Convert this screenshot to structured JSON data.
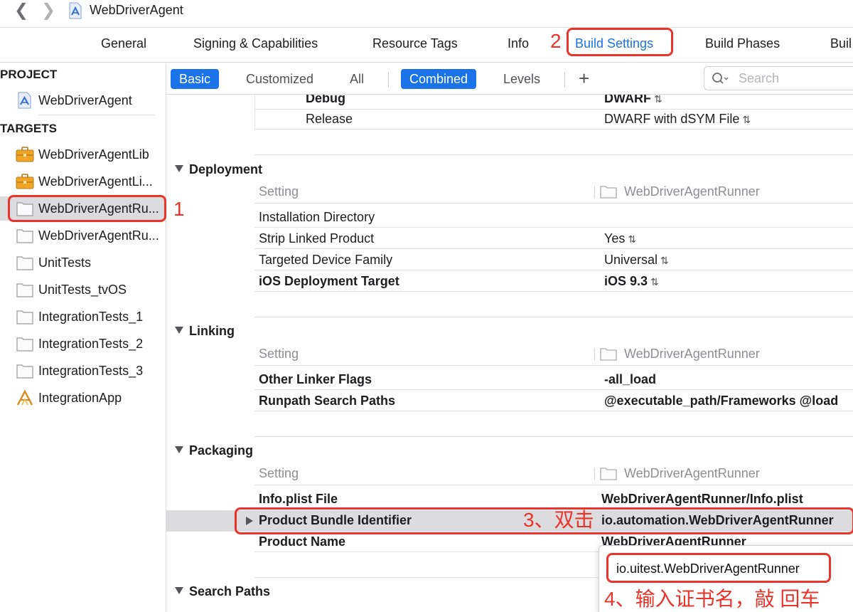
{
  "window": {
    "title": "WebDriverAgent"
  },
  "editor_tabs": [
    {
      "label": "General"
    },
    {
      "label": "Signing & Capabilities"
    },
    {
      "label": "Resource Tags"
    },
    {
      "label": "Info"
    },
    {
      "label": "Build Settings",
      "active": true
    },
    {
      "label": "Build Phases"
    },
    {
      "label": "Buil"
    }
  ],
  "sidebar": {
    "project_header": "PROJECT",
    "project_item": "WebDriverAgent",
    "targets_header": "TARGETS",
    "targets": [
      {
        "label": "WebDriverAgentLib",
        "icon": "toolbox-icon"
      },
      {
        "label": "WebDriverAgentLi...",
        "icon": "toolbox-icon"
      },
      {
        "label": "WebDriverAgentRu...",
        "icon": "test-bundle-icon",
        "selected": true
      },
      {
        "label": "WebDriverAgentRu...",
        "icon": "test-bundle-icon"
      },
      {
        "label": "UnitTests",
        "icon": "test-bundle-icon"
      },
      {
        "label": "UnitTests_tvOS",
        "icon": "test-bundle-icon"
      },
      {
        "label": "IntegrationTests_1",
        "icon": "test-bundle-icon"
      },
      {
        "label": "IntegrationTests_2",
        "icon": "test-bundle-icon"
      },
      {
        "label": "IntegrationTests_3",
        "icon": "test-bundle-icon"
      },
      {
        "label": "IntegrationApp",
        "icon": "app-icon"
      }
    ]
  },
  "filter_bar": {
    "basic": "Basic",
    "customized": "Customized",
    "all": "All",
    "combined": "Combined",
    "levels": "Levels",
    "add": "+",
    "search_placeholder": "Search"
  },
  "settings": {
    "top_rows": [
      {
        "name": "Debug",
        "value": "DWARF",
        "stepper": true
      },
      {
        "name": "Release",
        "value": "DWARF with dSYM File",
        "stepper": true
      }
    ],
    "column_header": "Setting",
    "target_column": "WebDriverAgentRunner",
    "deployment": {
      "title": "Deployment",
      "rows": [
        {
          "name": "Installation Directory",
          "value": "",
          "bold": false
        },
        {
          "name": "Strip Linked Product",
          "value": "Yes",
          "stepper": true,
          "bold": false
        },
        {
          "name": "Targeted Device Family",
          "value": "Universal",
          "stepper": true,
          "bold": false
        },
        {
          "name": "iOS Deployment Target",
          "value": "iOS 9.3",
          "stepper": true,
          "bold": true
        }
      ]
    },
    "linking": {
      "title": "Linking",
      "rows": [
        {
          "name": "Other Linker Flags",
          "value": "-all_load",
          "bold": true
        },
        {
          "name": "Runpath Search Paths",
          "value": "@executable_path/Frameworks @load",
          "bold": true
        }
      ]
    },
    "packaging": {
      "title": "Packaging",
      "rows": [
        {
          "name": "Info.plist File",
          "value": "WebDriverAgentRunner/Info.plist",
          "bold": true
        },
        {
          "name": "Product Bundle Identifier",
          "value": "io.automation.WebDriverAgentRunner",
          "bold": true
        },
        {
          "name": "Product Name",
          "value": "WebDriverAgentRunner",
          "bold": true
        }
      ]
    },
    "search_paths": {
      "title": "Search Paths"
    }
  },
  "popup": {
    "value": "io.uitest.WebDriverAgentRunner"
  },
  "annotations": {
    "step1": "1",
    "step2": "2",
    "step3": "3、双击",
    "step4": "4、输入证书名，敲 回车",
    "color": "#e8342b"
  },
  "colors": {
    "accent": "#1a73e8",
    "selection": "#dcdcde"
  }
}
